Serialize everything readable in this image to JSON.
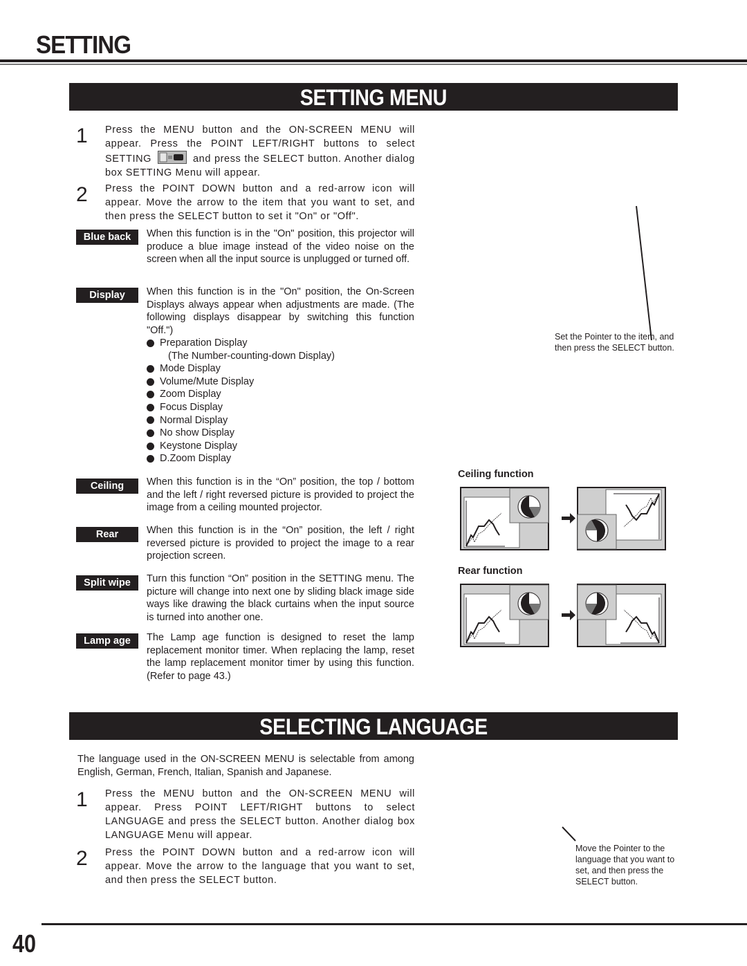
{
  "page_header": "SETTING",
  "setting_menu": {
    "title": "SETTING MENU",
    "steps": [
      {
        "num": "1",
        "text_before_icon": "Press the MENU button and the ON-SCREEN MENU will appear.  Press the POINT LEFT/RIGHT buttons to select SETTING",
        "icon": "setting-menu-icon",
        "text_after_icon": "and press the SELECT button.  Another dialog box SETTING Menu will appear."
      },
      {
        "num": "2",
        "text": "Press the POINT DOWN button and a red-arrow icon will appear.  Move the arrow to the item that you want to set, and then press the SELECT button to set it \"On\" or \"Off\"."
      }
    ],
    "functions": [
      {
        "label": "Blue back",
        "description": "When this function is in the \"On\" position, this projector will produce a blue image instead of the video noise on the screen when all the input source is unplugged or turned off."
      },
      {
        "label": "Display",
        "description": "When this function is in the \"On\" position, the On-Screen Displays always appear when adjustments are made.  (The following displays disappear by switching this function \"Off.\")"
      },
      {
        "label": "Ceiling",
        "description": "When this function is in the “On” position, the top / bottom and the left / right reversed picture is provided to project the image from a ceiling mounted projector."
      },
      {
        "label": "Rear",
        "description": "When this function is in the “On” position, the left / right reversed picture is provided to project the image to a rear projection screen."
      },
      {
        "label": "Split wipe",
        "description": "Turn this function “On” position in the SETTING menu. The picture will change into next one by sliding black image side ways like drawing the black curtains when the input source is turned into another one."
      },
      {
        "label": "Lamp age",
        "description": "The Lamp age function is designed to reset the lamp replacement monitor timer.  When replacing the lamp, reset the lamp replacement monitor timer by using this function.  (Refer to page 43.)"
      }
    ],
    "display_items": [
      {
        "text": "Preparation Display",
        "sub": "(The Number-counting-down Display)"
      },
      {
        "text": "Mode Display"
      },
      {
        "text": "Volume/Mute Display"
      },
      {
        "text": "Zoom Display"
      },
      {
        "text": "Focus Display"
      },
      {
        "text": "Normal Display"
      },
      {
        "text": "No show Display"
      },
      {
        "text": "Keystone Display"
      },
      {
        "text": "D.Zoom Display"
      }
    ],
    "pointer_caption": "Set the Pointer to the item, and then press the SELECT button.",
    "figures": [
      {
        "title": "Ceiling function"
      },
      {
        "title": "Rear function"
      }
    ]
  },
  "selecting_language": {
    "title": "SELECTING LANGUAGE",
    "intro": "The language used in the ON-SCREEN MENU is selectable from among English, German, French, Italian, Spanish and Japanese.",
    "steps": [
      {
        "num": "1",
        "text": "Press the MENU button and the ON-SCREEN MENU will appear.  Press POINT LEFT/RIGHT buttons to select LANGUAGE  and press the SELECT button.  Another dialog box LANGUAGE Menu will appear."
      },
      {
        "num": "2",
        "text": "Press the POINT DOWN button and a red-arrow icon will appear.  Move the arrow to the language that you want to set, and then press the SELECT button."
      }
    ],
    "pointer_caption": "Move the Pointer to the language that you want to set, and then press the SELECT button."
  },
  "page_number": "40"
}
